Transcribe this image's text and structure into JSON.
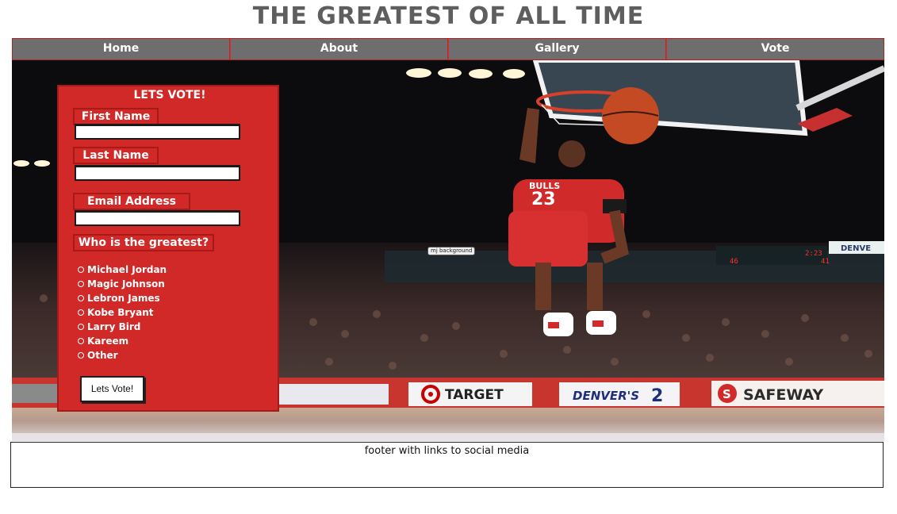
{
  "header": {
    "title": "THE GREATEST OF ALL TIME"
  },
  "nav": {
    "items": [
      "Home",
      "About",
      "Gallery",
      "Vote"
    ]
  },
  "hero": {
    "image_label": "mj background",
    "signs": {
      "target": "TARGET",
      "denvers": "DENVER'S",
      "denvers_num": "2",
      "safeway": "SAFEWAY",
      "denver_short": "DENVE",
      "jersey_team": "BULLS",
      "jersey_number": "23",
      "scoreboard_time": "2:23",
      "scoreboard_left": "46",
      "scoreboard_right": "41"
    }
  },
  "vote_form": {
    "title": "LETS VOTE!",
    "first_name_label": "First Name",
    "last_name_label": "Last Name",
    "email_label": "Email Address",
    "question": "Who is the greatest?",
    "options": [
      "Michael Jordan",
      "Magic Johnson",
      "Lebron James",
      "Kobe Bryant",
      "Larry Bird",
      "Kareem",
      "Other"
    ],
    "submit_label": "Lets Vote!"
  },
  "footer": {
    "text": "footer with links to social media"
  },
  "colors": {
    "accent_red": "#d12828",
    "nav_gray": "#6e6e6e",
    "title_gray": "#5e5e5e"
  }
}
